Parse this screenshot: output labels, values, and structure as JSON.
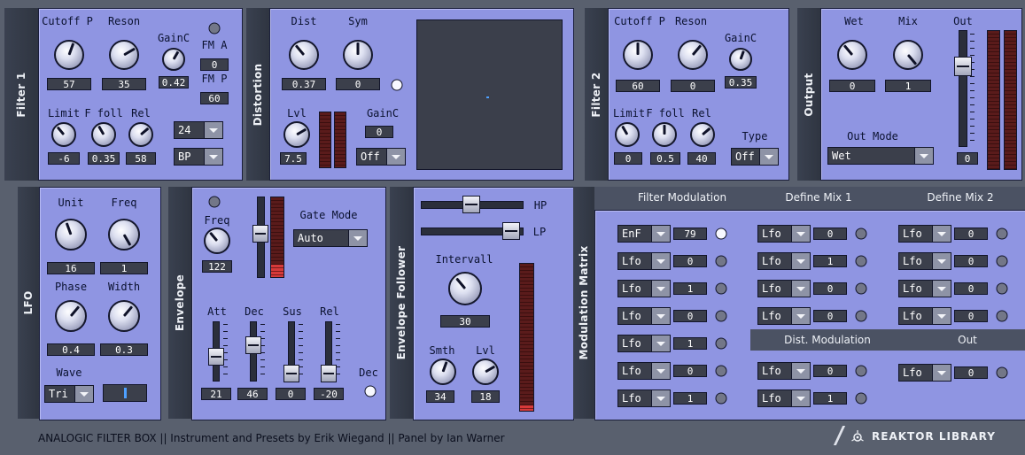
{
  "filter1": {
    "title": "Filter 1",
    "cutoff_label": "Cutoff P",
    "cutoff_value": "57",
    "reson_label": "Reson",
    "reson_value": "35",
    "gainc_label": "GainC",
    "gainc_value": "0.42",
    "fma_label": "FM A",
    "fma_value": "0",
    "fmp_label": "FM P",
    "fmp_value": "60",
    "limit_label": "Limit",
    "limit_value": "-6",
    "ffoll_label": "F foll",
    "ffoll_value": "0.35",
    "rel_label": "Rel",
    "rel_value": "58",
    "slope_value": "24",
    "type_value": "BP"
  },
  "distortion": {
    "title": "Distortion",
    "dist_label": "Dist",
    "dist_value": "0.37",
    "sym_label": "Sym",
    "sym_value": "0",
    "lvl_label": "Lvl",
    "lvl_value": "7.5",
    "gainc_label": "GainC",
    "gainc_value": "0",
    "mode_value": "Off"
  },
  "filter2": {
    "title": "Filter 2",
    "cutoff_label": "Cutoff P",
    "cutoff_value": "60",
    "reson_label": "Reson",
    "reson_value": "0",
    "gainc_label": "GainC",
    "gainc_value": "0.35",
    "limit_label": "Limit",
    "limit_value": "0",
    "ffoll_label": "F foll",
    "ffoll_value": "0.5",
    "rel_label": "Rel",
    "rel_value": "40",
    "type_label": "Type",
    "type_value": "Off"
  },
  "output": {
    "title": "Output",
    "wet_label": "Wet",
    "wet_value": "0",
    "mix_label": "Mix",
    "mix_value": "1",
    "out_label": "Out",
    "out_value": "0",
    "outmode_label": "Out Mode",
    "outmode_value": "Wet"
  },
  "lfo": {
    "title": "LFO",
    "unit_label": "Unit",
    "unit_value": "16",
    "freq_label": "Freq",
    "freq_value": "1",
    "phase_label": "Phase",
    "phase_value": "0.4",
    "width_label": "Width",
    "width_value": "0.3",
    "wave_label": "Wave",
    "wave_value": "Tri"
  },
  "envelope": {
    "title": "Envelope",
    "freq_label": "Freq",
    "freq_value": "122",
    "gatemode_label": "Gate Mode",
    "gatemode_value": "Auto",
    "att_label": "Att",
    "att_value": "21",
    "dec_label": "Dec",
    "dec_value": "46",
    "sus_label": "Sus",
    "sus_value": "0",
    "rel_label": "Rel",
    "rel_value": "-20",
    "dec2_label": "Dec"
  },
  "follower": {
    "title": "Envelope Follower",
    "hp_label": "HP",
    "lp_label": "LP",
    "intervall_label": "Intervall",
    "intervall_value": "30",
    "smth_label": "Smth",
    "smth_value": "34",
    "lvl_label": "Lvl",
    "lvl_value": "18"
  },
  "matrix": {
    "title": "Modulation Matrix",
    "col_filter": "Filter Modulation",
    "col_mix1": "Define Mix 1",
    "col_mix2": "Define Mix 2",
    "dist_mod_label": "Dist. Modulation",
    "out_label": "Out",
    "filter_rows": [
      {
        "src": "EnF",
        "val": "79"
      },
      {
        "src": "Lfo",
        "val": "0"
      },
      {
        "src": "Lfo",
        "val": "1"
      },
      {
        "src": "Lfo",
        "val": "0"
      },
      {
        "src": "Lfo",
        "val": "1"
      },
      {
        "src": "Lfo",
        "val": "0"
      },
      {
        "src": "Lfo",
        "val": "1"
      }
    ],
    "mix1_rows": [
      {
        "src": "Lfo",
        "val": "0"
      },
      {
        "src": "Lfo",
        "val": "1"
      },
      {
        "src": "Lfo",
        "val": "0"
      },
      {
        "src": "Lfo",
        "val": "0"
      }
    ],
    "mix2_rows": [
      {
        "src": "Lfo",
        "val": "0"
      },
      {
        "src": "Lfo",
        "val": "0"
      },
      {
        "src": "Lfo",
        "val": "0"
      },
      {
        "src": "Lfo",
        "val": "0"
      }
    ],
    "dist_rows": [
      {
        "src": "Lfo",
        "val": "0"
      },
      {
        "src": "Lfo",
        "val": "1"
      }
    ],
    "out_rows": [
      {
        "src": "Lfo",
        "val": "0"
      }
    ]
  },
  "footer": {
    "credits": "ANALOGIC FILTER BOX  ||  Instrument and Presets by Erik Wiegand  ||  Panel by Ian Warner",
    "brand": "REAKTOR LIBRARY"
  }
}
